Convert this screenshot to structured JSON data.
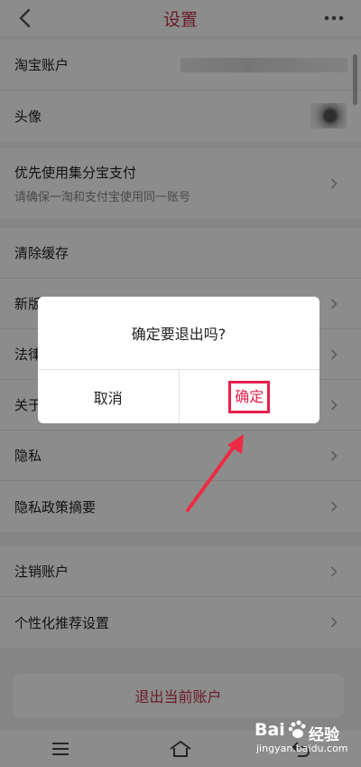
{
  "header": {
    "title": "设置"
  },
  "group1": {
    "items": [
      {
        "label": "淘宝账户"
      },
      {
        "label": "头像"
      }
    ]
  },
  "group2": {
    "items": [
      {
        "label": "优先使用集分宝支付",
        "sub": "请确保一淘和支付宝使用同一账号"
      }
    ]
  },
  "group3": {
    "items": [
      {
        "label": "清除缓存"
      },
      {
        "label": "新版"
      },
      {
        "label": "法律"
      },
      {
        "label": "关于"
      },
      {
        "label": "隐私"
      },
      {
        "label": "隐私政策摘要"
      }
    ]
  },
  "group4": {
    "items": [
      {
        "label": "注销账户"
      },
      {
        "label": "个性化推荐设置"
      }
    ]
  },
  "logout": {
    "label": "退出当前账户"
  },
  "dialog": {
    "message": "确定要退出吗?",
    "cancel_label": "取消",
    "confirm_label": "确定"
  },
  "watermark": {
    "brand": "Bai",
    "brand2": "经验",
    "url": "jingyan.baidu.com"
  },
  "colors": {
    "accent": "#c2344d",
    "highlight": "#e4214d"
  },
  "icons": {
    "back": "chevron-left-icon",
    "more": "more-dots-icon",
    "chevron": "chevron-right-icon"
  }
}
